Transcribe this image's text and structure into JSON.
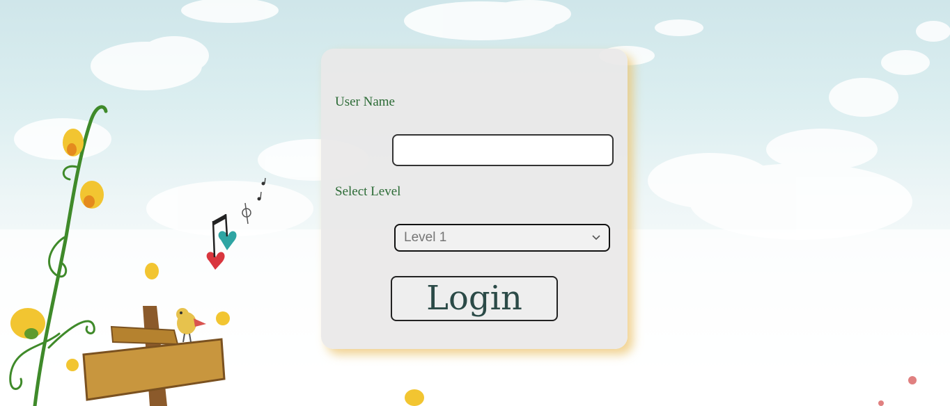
{
  "form": {
    "username_label": "User Name",
    "username_value": "",
    "level_label": "Select Level",
    "level_selected": "Level 1",
    "login_label": "Login"
  },
  "icons": {
    "select_arrow": "chevron-down-icon"
  },
  "colors": {
    "label_text": "#2c6b36",
    "card_background": "#eae8e8",
    "card_shadow": "#ecc46e",
    "button_text": "#2b4a47",
    "select_text": "#757575"
  }
}
